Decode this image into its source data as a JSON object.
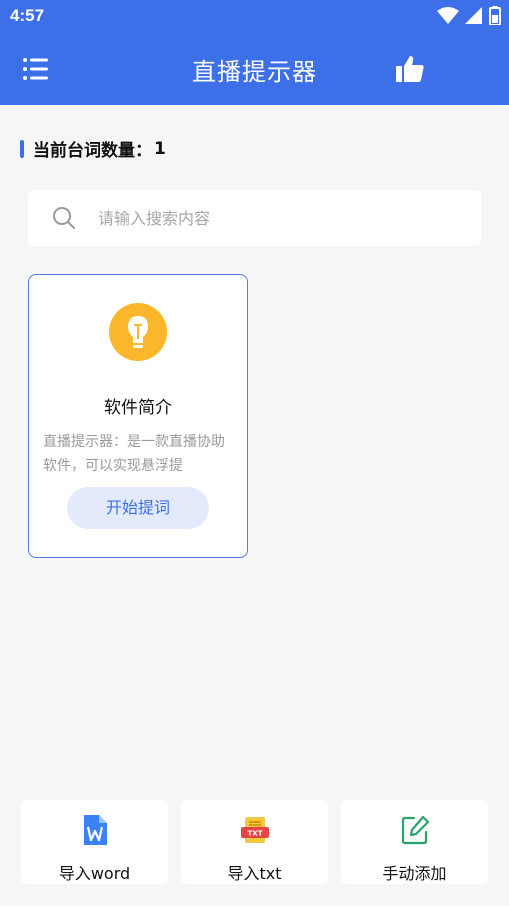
{
  "status": {
    "time": "4:57"
  },
  "appbar": {
    "title": "直播提示器"
  },
  "header": {
    "count_label": "当前台词数量：",
    "count_value": "1"
  },
  "search": {
    "placeholder": "请输入搜索内容"
  },
  "cards": [
    {
      "title": "软件简介",
      "description": "直播提示器：是一款直播协助软件，可以实现悬浮提",
      "button": "开始提词"
    }
  ],
  "actions": [
    {
      "label": "导入word",
      "icon": "word-file-icon"
    },
    {
      "label": "导入txt",
      "icon": "txt-file-icon"
    },
    {
      "label": "手动添加",
      "icon": "edit-icon"
    }
  ],
  "colors": {
    "primary": "#3d70e8",
    "bulb": "#fbb62b",
    "word": "#3b82f6",
    "txt": "#e64545",
    "edit": "#2aa36b"
  }
}
